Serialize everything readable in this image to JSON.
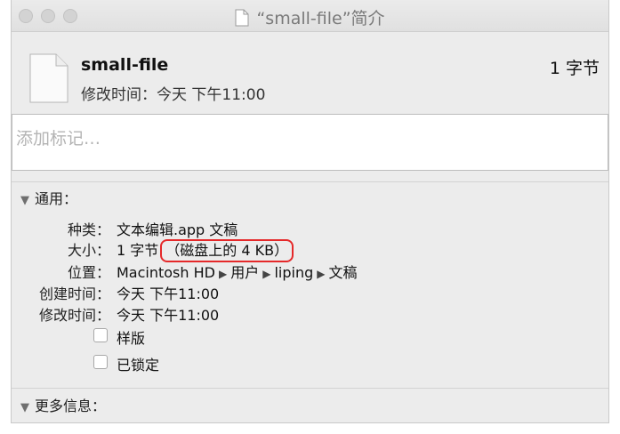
{
  "window": {
    "title": "“small-file”简介"
  },
  "file": {
    "name": "small-file",
    "modified_line": "修改时间：今天 下午11:00",
    "size": "1 字节"
  },
  "tags": {
    "placeholder": "添加标记…"
  },
  "general": {
    "header": "通用：",
    "kind_label": "种类：",
    "kind_value": "文本编辑.app 文稿",
    "size_label": "大小：",
    "size_value_prefix": "1 字节",
    "size_value_disk": "（磁盘上的 4 KB）",
    "where_label": "位置：",
    "where_path": [
      "Macintosh HD",
      "用户",
      "liping",
      "文稿"
    ],
    "created_label": "创建时间：",
    "created_value": "今天 下午11:00",
    "modified_label": "修改时间：",
    "modified_value": "今天 下午11:00",
    "stationery_label": "样版",
    "locked_label": "已锁定"
  },
  "more_info": {
    "header": "更多信息："
  },
  "colors": {
    "highlight": "#e5292a",
    "window_bg": "#ececec"
  }
}
